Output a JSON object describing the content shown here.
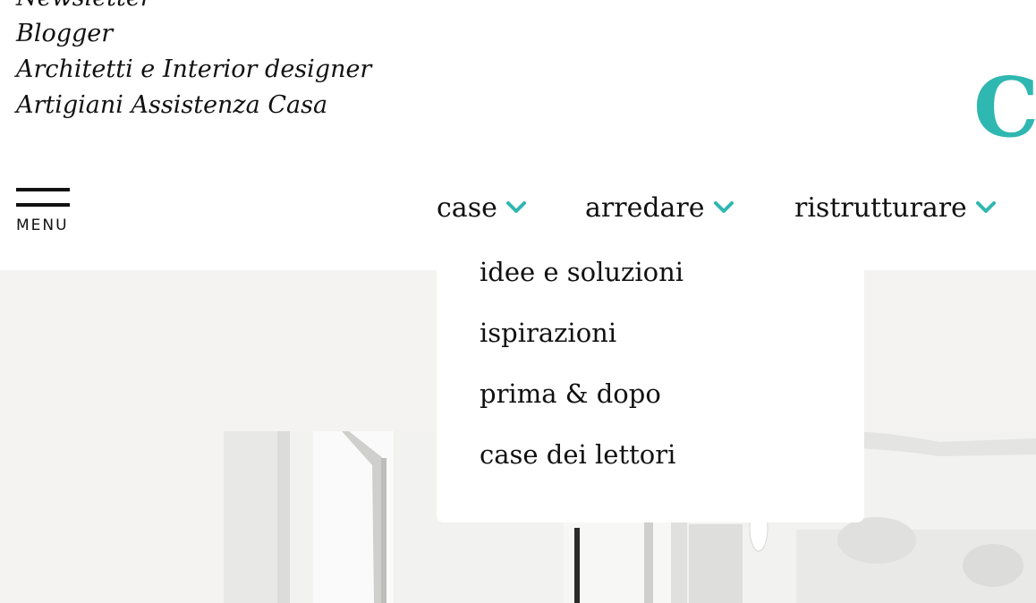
{
  "top_links": [
    "Newsletter",
    "Blogger",
    "Architetti e Interior designer",
    "Artigiani Assistenza Casa"
  ],
  "logo": {
    "text_fragment": "C.",
    "color": "#2fb7b1"
  },
  "menu": {
    "label": "MENU"
  },
  "nav": {
    "items": [
      {
        "label": "case",
        "icon": "chevron-down-icon"
      },
      {
        "label": "arredare",
        "icon": "chevron-down-icon"
      },
      {
        "label": "ristrutturare",
        "icon": "chevron-down-icon"
      }
    ],
    "accent_color": "#2fb7b1"
  },
  "dropdown": {
    "parent": "case",
    "items": [
      "idee e soluzioni",
      "ispirazioni",
      "prima & dopo",
      "case dei lettori"
    ]
  },
  "colors": {
    "hero_background": "#f4f3f1",
    "text": "#111111"
  }
}
